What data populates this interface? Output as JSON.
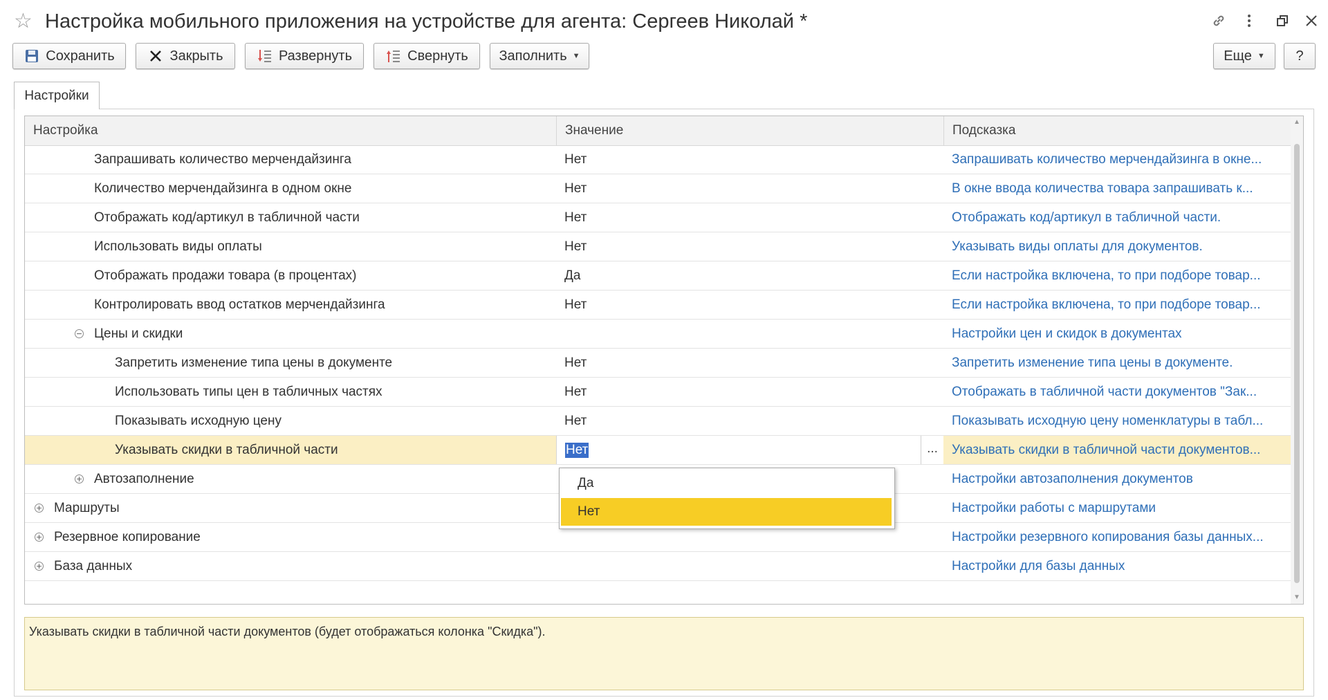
{
  "window": {
    "title": "Настройка мобильного приложения на устройстве для агента: Сергеев Николай *"
  },
  "toolbar": {
    "save": "Сохранить",
    "close": "Закрыть",
    "expand": "Развернуть",
    "collapse": "Свернуть",
    "fill": "Заполнить",
    "more": "Еще",
    "help": "?"
  },
  "tabs": [
    {
      "label": "Настройки"
    }
  ],
  "table": {
    "columns": [
      "Настройка",
      "Значение",
      "Подсказка"
    ],
    "rows": [
      {
        "level": 2,
        "toggle": "",
        "name": "Запрашивать количество мерчендайзинга",
        "value": "Нет",
        "hint": "Запрашивать количество мерчендайзинга в окне..."
      },
      {
        "level": 2,
        "toggle": "",
        "name": "Количество мерчендайзинга в одном окне",
        "value": "Нет",
        "hint": "В окне ввода количества товара запрашивать к..."
      },
      {
        "level": 2,
        "toggle": "",
        "name": "Отображать код/артикул в табличной части",
        "value": "Нет",
        "hint": "Отображать код/артикул в табличной части."
      },
      {
        "level": 2,
        "toggle": "",
        "name": "Использовать виды оплаты",
        "value": "Нет",
        "hint": "Указывать виды оплаты для документов."
      },
      {
        "level": 2,
        "toggle": "",
        "name": "Отображать продажи товара (в процентах)",
        "value": "Да",
        "hint": "Если настройка включена, то при подборе товар..."
      },
      {
        "level": 2,
        "toggle": "",
        "name": "Контролировать ввод остатков мерчендайзинга",
        "value": "Нет",
        "hint": "Если настройка включена, то при подборе товар..."
      },
      {
        "level": 1,
        "toggle": "collapse",
        "name": "Цены и скидки",
        "value": "",
        "hint": "Настройки цен и скидок в документах"
      },
      {
        "level": 3,
        "toggle": "",
        "name": "Запретить изменение типа цены в документе",
        "value": "Нет",
        "hint": "Запретить изменение типа цены в документе."
      },
      {
        "level": 3,
        "toggle": "",
        "name": "Использовать типы цен в табличных частях",
        "value": "Нет",
        "hint": "Отображать в табличной части документов \"Зак..."
      },
      {
        "level": 3,
        "toggle": "",
        "name": "Показывать исходную цену",
        "value": "Нет",
        "hint": "Показывать исходную цену номенклатуры в табл..."
      },
      {
        "level": 3,
        "toggle": "",
        "name": "Указывать скидки в табличной части",
        "value": "Нет",
        "hint": "Указывать скидки в табличной части документов...",
        "selected": true,
        "editing": true
      },
      {
        "level": 1,
        "toggle": "expand",
        "name": "Автозаполнение",
        "value": "",
        "hint": "Настройки автозаполнения документов"
      },
      {
        "level": 0,
        "toggle": "expand",
        "name": "Маршруты",
        "value": "",
        "hint": "Настройки работы с маршрутами"
      },
      {
        "level": 0,
        "toggle": "expand",
        "name": "Резервное копирование",
        "value": "",
        "hint": "Настройки резервного копирования базы данных..."
      },
      {
        "level": 0,
        "toggle": "expand",
        "name": "База данных",
        "value": "",
        "hint": "Настройки для базы данных"
      }
    ]
  },
  "dropdown": {
    "options": [
      "Да",
      "Нет"
    ],
    "highlighted": "Нет"
  },
  "hint_panel": {
    "text": "Указывать скидки в табличной части документов (будет отображаться колонка \"Скидка\")."
  },
  "colors": {
    "link": "#2f6fb7",
    "selected_row": "#fbefc4",
    "dropdown_highlight": "#f7cd25",
    "hint_bg": "#fcf6d8",
    "text_selection": "#3a6ec9"
  }
}
